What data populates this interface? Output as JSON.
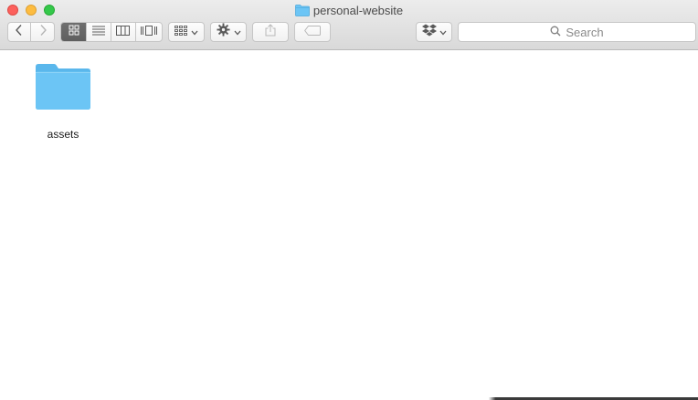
{
  "window": {
    "title": "personal-website",
    "title_icon": "folder-icon"
  },
  "toolbar": {
    "back_icon": "chevron-left-icon",
    "forward_icon": "chevron-right-icon",
    "view_modes": [
      "icon-view",
      "list-view",
      "column-view",
      "cover-flow-view"
    ],
    "active_view": "icon-view",
    "arrange_icon": "arrange-grid-icon",
    "action_icon": "gear-icon",
    "share_icon": "share-icon",
    "tag_icon": "tag-icon",
    "dropbox_icon": "dropbox-icon",
    "search": {
      "placeholder": "Search"
    }
  },
  "files": [
    {
      "name": "assets",
      "kind": "folder",
      "icon": "folder-icon"
    }
  ],
  "colors": {
    "folder": "#6cc5f5",
    "folder_tab": "#5ab7ec",
    "close": "#fc605c",
    "minimize": "#fdbc40",
    "zoom": "#34c84a"
  }
}
